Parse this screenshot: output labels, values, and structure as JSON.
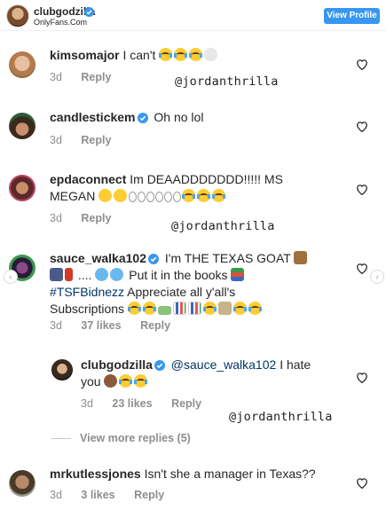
{
  "header": {
    "username": "clubgodzilla",
    "subtitle": "OnlyFans.Com",
    "view_profile": "View Profile"
  },
  "comments": [
    {
      "username": "kimsomajor",
      "text": "I can't",
      "emojis": [
        "loudly-crying-face",
        "loudly-crying-face",
        "loudly-crying-face",
        "skull"
      ],
      "time": "3d",
      "reply": "Reply"
    },
    {
      "username": "candlestickem",
      "text": "Oh no lol",
      "verified": true,
      "time": "3d",
      "reply": "Reply"
    },
    {
      "username": "epdaconnect",
      "text_line1": "Im DEAADDDDDDD!!!!! MS",
      "text_line2": "MEGAN",
      "emojis": [
        "anguished-face",
        "anguished-face",
        "eyes",
        "eyes",
        "eyes",
        "loudly-crying-face",
        "loudly-crying-face",
        "loudly-crying-face"
      ],
      "time": "3d",
      "reply": "Reply"
    },
    {
      "username": "sauce_walka102",
      "verified": true,
      "text_line1": "I'm THE TEXAS GOAT",
      "text_line2_mid": ".... ",
      "text_line2_end": "Put it in the books",
      "hashtag": "#TSFBidnezz",
      "text_line3_end": "Appreciate all y'all's",
      "text_line4": "Subscriptions",
      "emojis": [
        "goat",
        "dancer",
        "fire-extinguisher",
        "droplets",
        "droplets",
        "books",
        "rofl",
        "rofl",
        "money",
        "chart",
        "chart",
        "joy",
        "bank",
        "joy",
        "joy"
      ],
      "time": "3d",
      "likes": "37 likes",
      "reply": "Reply"
    },
    {
      "username": "clubgodzilla",
      "verified": true,
      "mention": "@sauce_walka102",
      "text_after_mention": "I hate",
      "text_line2": "you",
      "emojis": [
        "person-facepalming",
        "rofl",
        "rofl"
      ],
      "time": "3d",
      "likes": "23 likes",
      "reply": "Reply"
    },
    {
      "username": "mrkutlessjones",
      "text": "Isn't she a manager in Texas??",
      "time": "3d",
      "likes": "3 likes",
      "reply": "Reply"
    }
  ],
  "view_more_replies": "View more replies (5)",
  "watermarks": [
    "@jordanthrilla",
    "@jordanthrilla",
    "@jordanthrilla"
  ],
  "colors": {
    "accent": "#3897f0",
    "verified": "#3897f0",
    "meta_text": "#8e8e8e",
    "link": "#003569"
  }
}
